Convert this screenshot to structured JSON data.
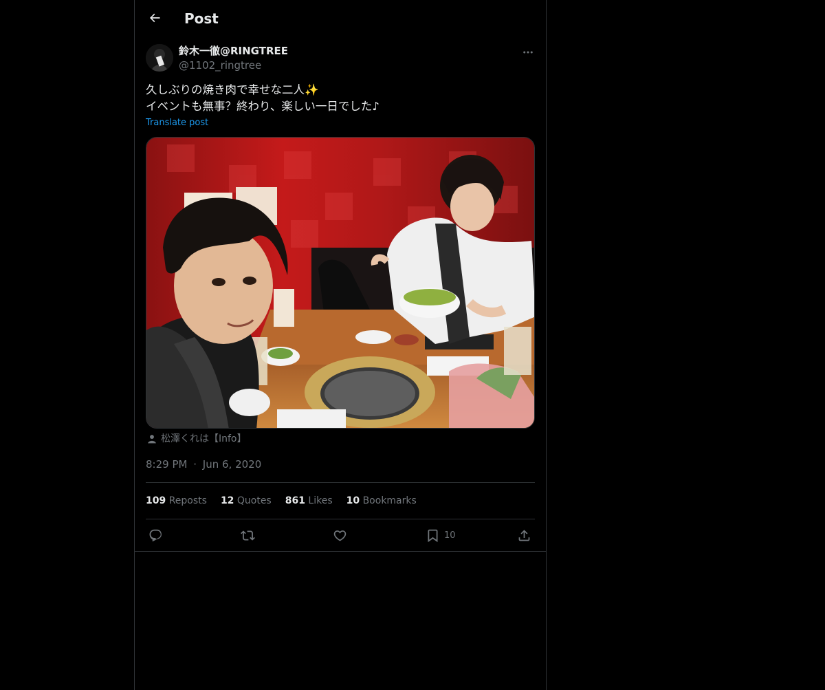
{
  "header": {
    "title": "Post"
  },
  "author": {
    "name": "鈴木一徹@RINGTREE",
    "handle": "@1102_ringtree"
  },
  "post": {
    "lines": [
      "久しぶりの焼き肉で幸せな二人✨",
      "イベントも無事？終わり、楽しい一日でした♪"
    ],
    "translate_label": "Translate post",
    "tagged_user": "松澤くれは【Info】",
    "time": "8:29 PM",
    "separator": "·",
    "date": "Jun 6, 2020"
  },
  "stats": [
    {
      "value": "109",
      "label": "Reposts"
    },
    {
      "value": "12",
      "label": "Quotes"
    },
    {
      "value": "861",
      "label": "Likes"
    },
    {
      "value": "10",
      "label": "Bookmarks"
    }
  ],
  "actions": {
    "bookmark_count": "10"
  },
  "icons": [
    "back-arrow-icon",
    "more-icon",
    "person-icon",
    "reply-icon",
    "repost-icon",
    "like-icon",
    "bookmark-icon",
    "share-icon"
  ],
  "colors": {
    "background": "#000000",
    "text": "#e7e9ea",
    "muted": "#71767b",
    "link": "#1d9bf0",
    "border": "#2f3336"
  }
}
